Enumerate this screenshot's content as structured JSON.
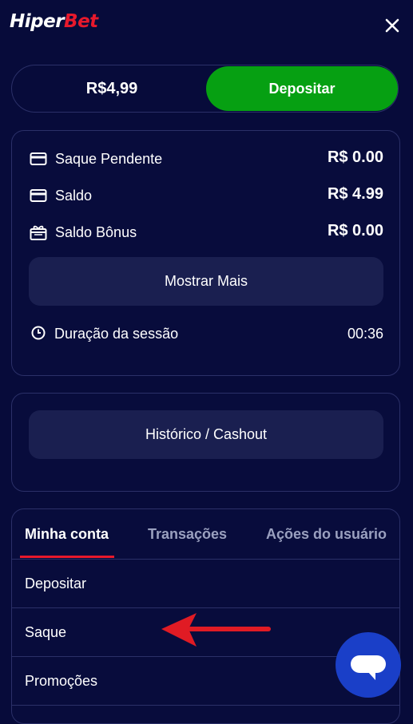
{
  "header": {
    "logo_part1": "Hiper",
    "logo_part2": "Bet",
    "close_icon": "close-icon"
  },
  "wallet": {
    "balance": "R$4,99",
    "deposit_label": "Depositar"
  },
  "balances": [
    {
      "label": "Saque Pendente",
      "value": "R$ 0.00",
      "icon": "card-icon"
    },
    {
      "label": "Saldo",
      "value": "R$ 4.99",
      "icon": "card-icon"
    },
    {
      "label": "Saldo Bônus",
      "value": "R$ 0.00",
      "icon": "gift-icon"
    }
  ],
  "show_more_label": "Mostrar Mais",
  "session": {
    "label": "Duração da sessão",
    "value": "00:36",
    "icon": "clock-icon"
  },
  "history_label": "Histórico / Cashout",
  "tabs": [
    {
      "label": "Minha conta",
      "active": true
    },
    {
      "label": "Transações",
      "active": false
    },
    {
      "label": "Ações do usuário",
      "active": false
    }
  ],
  "menu": [
    {
      "label": "Depositar"
    },
    {
      "label": "Saque"
    },
    {
      "label": "Promoções"
    }
  ],
  "colors": {
    "background": "#070b3a",
    "brand_red": "#e8192c",
    "deposit_green": "#06a012",
    "chat_blue": "#1a3fc8"
  },
  "chat_icon": "chat-bubble-icon",
  "annotation_icon": "red-arrow-icon"
}
